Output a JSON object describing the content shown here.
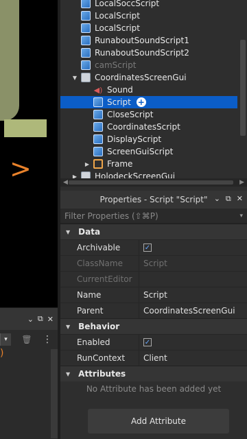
{
  "viewport": {
    "glyph": ">"
  },
  "output_panel": {
    "controls": {
      "collapse": "⌄",
      "popout": "⧉",
      "close": "✕"
    },
    "filter_dropdown": "▾",
    "trash": "🗑",
    "more": "⋮",
    "paren": ")"
  },
  "explorer": {
    "items": [
      {
        "label": "LocalSoccScript",
        "icon": "script-icon",
        "indent": 1
      },
      {
        "label": "LocalScript",
        "icon": "script-icon",
        "indent": 1
      },
      {
        "label": "LocalScript",
        "icon": "script-icon",
        "indent": 1
      },
      {
        "label": "RunaboutSoundScript1",
        "icon": "script-icon",
        "indent": 1
      },
      {
        "label": "RunaboutSoundScript2",
        "icon": "script-icon",
        "indent": 1
      },
      {
        "label": "camScript",
        "icon": "script-icon",
        "indent": 1,
        "dim": true
      },
      {
        "label": "CoordinatesScreenGui",
        "icon": "screengui-icon",
        "indent": 1,
        "expanded": true
      },
      {
        "label": "Sound",
        "icon": "sound-icon",
        "indent": 2
      },
      {
        "label": "Script",
        "icon": "script-icon",
        "indent": 2,
        "selected": true
      },
      {
        "label": "CloseScript",
        "icon": "script-icon",
        "indent": 2
      },
      {
        "label": "CoordinatesScript",
        "icon": "script-icon",
        "indent": 2
      },
      {
        "label": "DisplayScript",
        "icon": "script-icon",
        "indent": 2
      },
      {
        "label": "ScreenGuiScript",
        "icon": "script-icon",
        "indent": 2
      },
      {
        "label": "Frame",
        "icon": "frame-icon",
        "indent": 2,
        "collapsed": true
      },
      {
        "label": "HolodeckScreenGui",
        "icon": "screengui-icon",
        "indent": 1,
        "collapsed": true
      }
    ]
  },
  "properties": {
    "title": "Properties - Script \"Script\"",
    "filter_placeholder": "Filter Properties (⇧⌘P)",
    "sections": {
      "data": "Data",
      "behavior": "Behavior",
      "attributes": "Attributes"
    },
    "data_props": [
      {
        "key": "Archivable",
        "value": "",
        "checkbox": true
      },
      {
        "key": "ClassName",
        "value": "Script",
        "dim": true
      },
      {
        "key": "CurrentEditor",
        "value": "",
        "dim": true
      },
      {
        "key": "Name",
        "value": "Script"
      },
      {
        "key": "Parent",
        "value": "CoordinatesScreenGui"
      }
    ],
    "behavior_props": [
      {
        "key": "Enabled",
        "value": "",
        "checkbox": true
      },
      {
        "key": "RunContext",
        "value": "Client"
      }
    ],
    "no_attributes": "No Attribute has been added yet",
    "add_attribute": "Add Attribute"
  }
}
